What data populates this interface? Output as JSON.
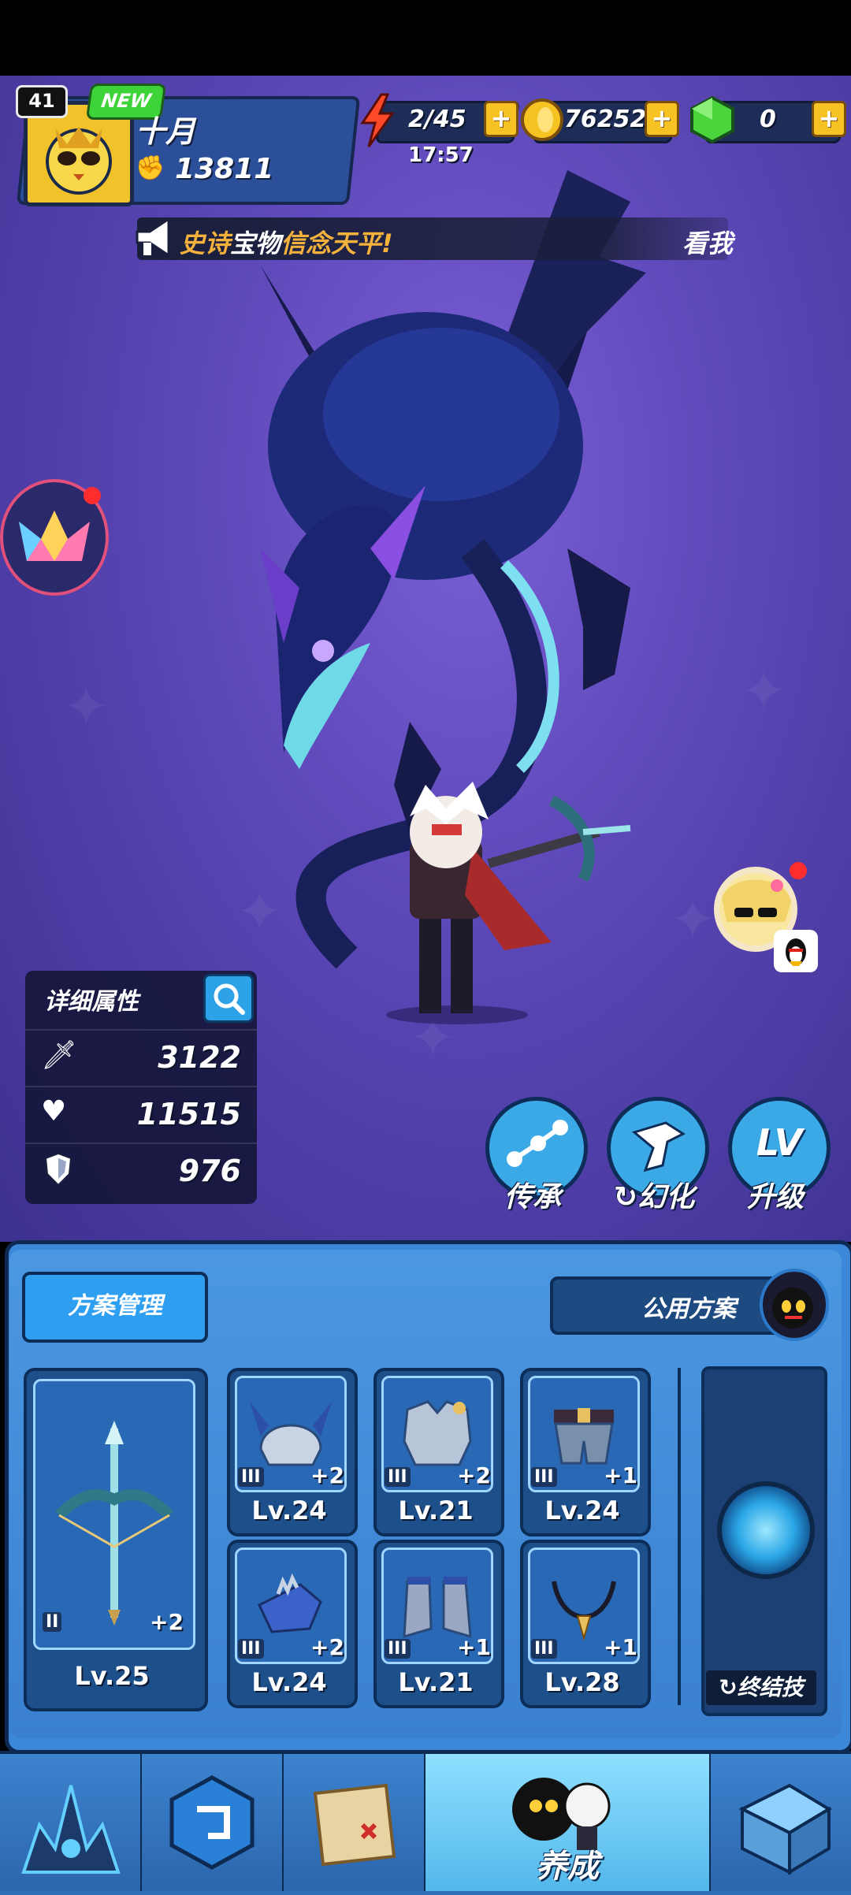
{
  "player": {
    "level": "41",
    "new_badge": "NEW",
    "name": "十月",
    "power": "13811"
  },
  "resources": {
    "energy": "2/45",
    "energy_timer": "17:57",
    "gold": "76252",
    "gems": "0",
    "plus": "+"
  },
  "ticker": {
    "part1": "史诗",
    "part2": "宝物",
    "part3": "信念天平!",
    "trailing": "看我"
  },
  "stats": {
    "title": "详细属性",
    "attack": "3122",
    "hp": "11515",
    "defense": "976"
  },
  "actions": {
    "inherit": "传承",
    "transform": "幻化",
    "upgrade": "升级",
    "upgrade_icon_text": "LV"
  },
  "loadout": {
    "plan_manage": "方案管理",
    "public_plan": "公用方案",
    "weapon": {
      "tier": "II",
      "plus": "+2",
      "level": "Lv.25"
    },
    "slots": [
      {
        "tier": "III",
        "plus": "+2",
        "level": "Lv.24"
      },
      {
        "tier": "III",
        "plus": "+2",
        "level": "Lv.21"
      },
      {
        "tier": "III",
        "plus": "+1",
        "level": "Lv.24"
      },
      {
        "tier": "III",
        "plus": "+2",
        "level": "Lv.24"
      },
      {
        "tier": "III",
        "plus": "+1",
        "level": "Lv.21"
      },
      {
        "tier": "III",
        "plus": "+1",
        "level": "Lv.28"
      }
    ],
    "ultimate": "终结技"
  },
  "nav": {
    "active_label": "养成"
  },
  "colors": {
    "scene_bg": "#5d48b8",
    "panel_bg": "#3c87d8",
    "gold_button": "#f7c324",
    "new_badge": "#3fd33a",
    "ticker_orange": "#f4b23c"
  }
}
